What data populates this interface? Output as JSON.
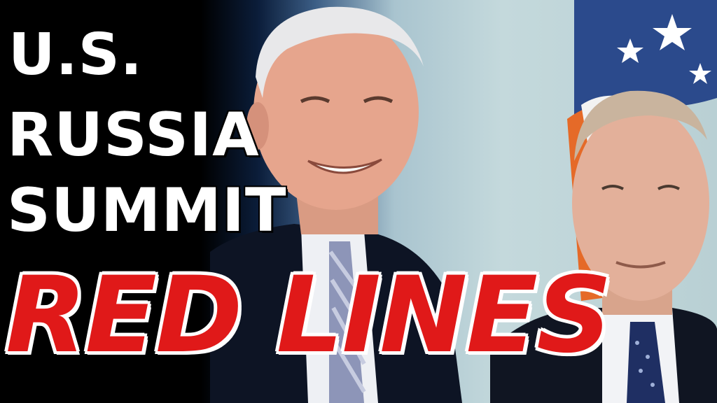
{
  "headline": {
    "line1": "U.S.",
    "line2": "RUSSIA",
    "line3": "SUMMIT",
    "emphasis": "RED LINES"
  },
  "colors": {
    "headline_text": "#ffffff",
    "emphasis_text": "#e01919",
    "background_left": "#000000",
    "backdrop": "#c4d9dc"
  },
  "scene": {
    "left_person": "smiling older man with white hair in dark suit and striped tie",
    "right_person": "man in dark suit with blue dotted tie",
    "flag": "american-flag"
  }
}
